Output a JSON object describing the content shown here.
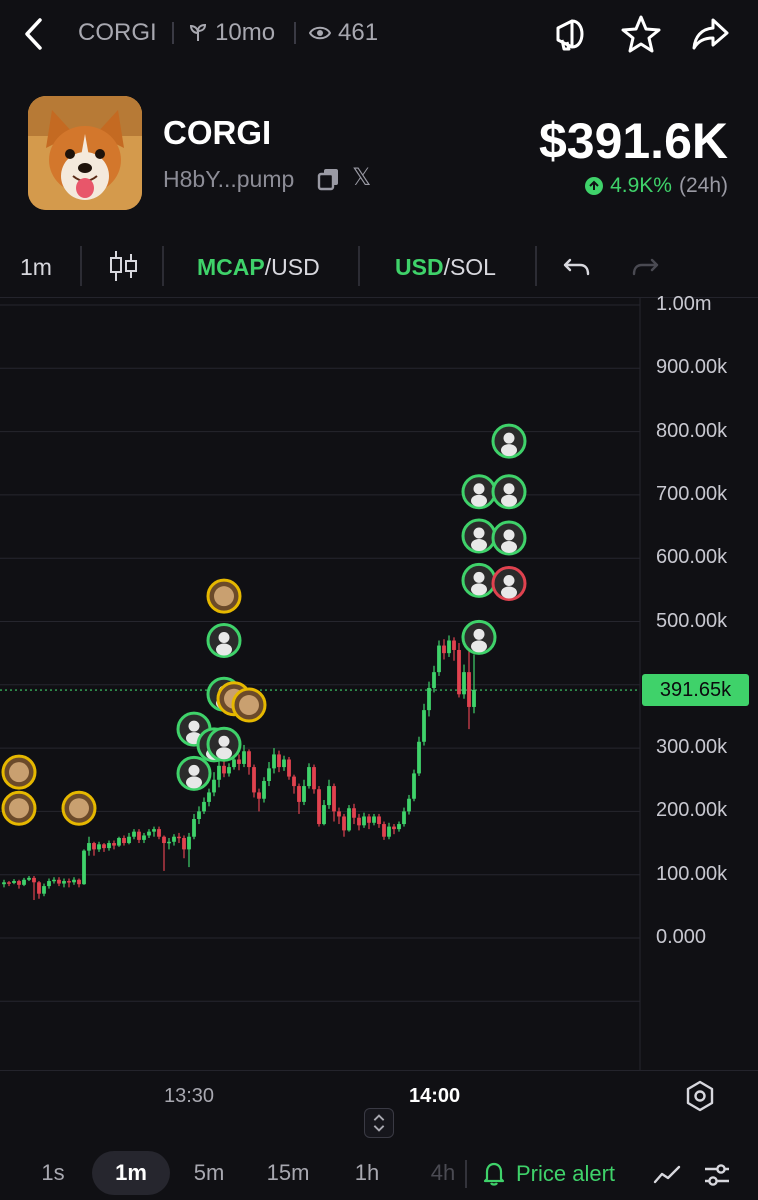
{
  "topbar": {
    "back_icon": "chevron-left-icon",
    "symbol": "CORGI",
    "age_icon": "sprout-icon",
    "age": "10mo",
    "views_icon": "eye-icon",
    "views": "461",
    "icons": [
      "megaphone-icon",
      "star-icon",
      "share-icon"
    ]
  },
  "token": {
    "name": "CORGI",
    "address": "H8bY...pump",
    "copy_icon": "copy-icon",
    "x_label": "𝕏",
    "market_cap": "$391.6K",
    "change": "4.9K%",
    "period": "(24h)",
    "accent": "#3fd26a"
  },
  "toolbar": {
    "interval": "1m",
    "candles_icon": "candlestick-icon",
    "mcap_a": "MCAP",
    "mcap_b": "/USD",
    "cur_a": "USD",
    "cur_b": "/SOL",
    "undo_icon": "undo-icon",
    "redo_icon": "redo-icon"
  },
  "chart_data": {
    "type": "candlestick",
    "y_ticks": [
      "1.00m",
      "900.00k",
      "800.00k",
      "700.00k",
      "600.00k",
      "500.00k",
      "300.00k",
      "200.00k",
      "100.00k",
      "0.000"
    ],
    "y_range": [
      -100000,
      1000000
    ],
    "x_ticks": [
      "13:30",
      "14:00"
    ],
    "last_price_label": "391.65k",
    "last_price": 391650,
    "up_color": "#3fd26a",
    "down_color": "#e0424f",
    "grid": true,
    "candles": [
      [
        85,
        88,
        80,
        92
      ],
      [
        88,
        87,
        82,
        90
      ],
      [
        87,
        90,
        85,
        93
      ],
      [
        90,
        84,
        78,
        92
      ],
      [
        84,
        92,
        82,
        95
      ],
      [
        92,
        95,
        90,
        98
      ],
      [
        95,
        88,
        60,
        98
      ],
      [
        88,
        70,
        62,
        90
      ],
      [
        70,
        82,
        66,
        86
      ],
      [
        82,
        90,
        78,
        94
      ],
      [
        90,
        92,
        86,
        96
      ],
      [
        92,
        86,
        82,
        96
      ],
      [
        86,
        90,
        80,
        94
      ],
      [
        90,
        88,
        80,
        94
      ],
      [
        88,
        92,
        84,
        96
      ],
      [
        92,
        85,
        80,
        94
      ],
      [
        85,
        138,
        84,
        140
      ],
      [
        138,
        150,
        130,
        160
      ],
      [
        150,
        140,
        130,
        152
      ],
      [
        140,
        148,
        136,
        152
      ],
      [
        148,
        142,
        136,
        150
      ],
      [
        142,
        150,
        138,
        154
      ],
      [
        150,
        146,
        140,
        154
      ],
      [
        146,
        158,
        144,
        160
      ],
      [
        158,
        150,
        146,
        162
      ],
      [
        150,
        160,
        148,
        166
      ],
      [
        160,
        168,
        156,
        172
      ],
      [
        168,
        155,
        150,
        172
      ],
      [
        155,
        162,
        150,
        166
      ],
      [
        162,
        168,
        158,
        172
      ],
      [
        168,
        172,
        160,
        176
      ],
      [
        172,
        160,
        156,
        176
      ],
      [
        160,
        150,
        106,
        162
      ],
      [
        150,
        152,
        140,
        158
      ],
      [
        152,
        160,
        146,
        164
      ],
      [
        160,
        158,
        150,
        166
      ],
      [
        158,
        140,
        126,
        162
      ],
      [
        140,
        160,
        112,
        166
      ],
      [
        160,
        188,
        156,
        196
      ],
      [
        188,
        200,
        180,
        208
      ],
      [
        200,
        215,
        196,
        222
      ],
      [
        215,
        230,
        208,
        236
      ],
      [
        230,
        250,
        224,
        262
      ],
      [
        250,
        272,
        238,
        300
      ],
      [
        272,
        260,
        254,
        280
      ],
      [
        260,
        270,
        255,
        276
      ],
      [
        270,
        282,
        266,
        290
      ],
      [
        282,
        275,
        265,
        290
      ],
      [
        275,
        295,
        270,
        305
      ],
      [
        295,
        270,
        258,
        298
      ],
      [
        270,
        230,
        222,
        274
      ],
      [
        230,
        220,
        200,
        236
      ],
      [
        220,
        248,
        214,
        254
      ],
      [
        248,
        268,
        240,
        278
      ],
      [
        268,
        290,
        260,
        300
      ],
      [
        290,
        270,
        262,
        296
      ],
      [
        270,
        282,
        264,
        288
      ],
      [
        282,
        255,
        250,
        286
      ],
      [
        255,
        240,
        228,
        258
      ],
      [
        240,
        215,
        196,
        244
      ],
      [
        215,
        240,
        210,
        250
      ],
      [
        240,
        270,
        236,
        276
      ],
      [
        270,
        235,
        228,
        274
      ],
      [
        235,
        180,
        176,
        240
      ],
      [
        180,
        210,
        178,
        218
      ],
      [
        210,
        240,
        204,
        250
      ],
      [
        240,
        200,
        184,
        244
      ],
      [
        200,
        192,
        180,
        206
      ],
      [
        192,
        170,
        160,
        196
      ],
      [
        170,
        205,
        168,
        210
      ],
      [
        205,
        190,
        180,
        212
      ],
      [
        190,
        178,
        170,
        196
      ],
      [
        178,
        192,
        174,
        198
      ],
      [
        192,
        182,
        172,
        196
      ],
      [
        182,
        192,
        178,
        196
      ],
      [
        192,
        180,
        174,
        196
      ],
      [
        180,
        160,
        155,
        184
      ],
      [
        160,
        176,
        156,
        182
      ],
      [
        176,
        172,
        164,
        180
      ],
      [
        172,
        180,
        168,
        184
      ],
      [
        180,
        200,
        176,
        206
      ],
      [
        200,
        220,
        195,
        226
      ],
      [
        220,
        260,
        216,
        266
      ],
      [
        260,
        310,
        256,
        318
      ],
      [
        310,
        360,
        304,
        370
      ],
      [
        360,
        395,
        350,
        405
      ],
      [
        395,
        420,
        388,
        430
      ],
      [
        420,
        462,
        414,
        470
      ],
      [
        462,
        450,
        440,
        472
      ],
      [
        450,
        470,
        444,
        478
      ],
      [
        470,
        455,
        438,
        475
      ],
      [
        455,
        385,
        380,
        466
      ],
      [
        385,
        420,
        378,
        432
      ],
      [
        420,
        365,
        330,
        456
      ],
      [
        365,
        392,
        355,
        448
      ]
    ],
    "markers": [
      {
        "t": 2,
        "v": 262,
        "kind": "token",
        "color": "#e6b800"
      },
      {
        "t": 2,
        "v": 205,
        "kind": "token",
        "color": "#e6b800"
      },
      {
        "t": 14,
        "v": 205,
        "kind": "token",
        "color": "#e6b800"
      },
      {
        "t": 37,
        "v": 260,
        "kind": "user",
        "color": "#3fd26a"
      },
      {
        "t": 37,
        "v": 330,
        "kind": "user",
        "color": "#3fd26a"
      },
      {
        "t": 41,
        "v": 305,
        "kind": "user",
        "color": "#3fd26a"
      },
      {
        "t": 43,
        "v": 306,
        "kind": "user",
        "color": "#3fd26a"
      },
      {
        "t": 43,
        "v": 385,
        "kind": "user",
        "color": "#3fd26a"
      },
      {
        "t": 43,
        "v": 470,
        "kind": "user",
        "color": "#3fd26a"
      },
      {
        "t": 43,
        "v": 540,
        "kind": "token",
        "color": "#e6b800"
      },
      {
        "t": 45,
        "v": 378,
        "kind": "token",
        "color": "#e6b800"
      },
      {
        "t": 48,
        "v": 368,
        "kind": "token",
        "color": "#e6b800"
      },
      {
        "t": 94,
        "v": 475,
        "kind": "user",
        "color": "#3fd26a"
      },
      {
        "t": 94,
        "v": 565,
        "kind": "user",
        "color": "#3fd26a"
      },
      {
        "t": 94,
        "v": 635,
        "kind": "user",
        "color": "#3fd26a"
      },
      {
        "t": 94,
        "v": 705,
        "kind": "user",
        "color": "#3fd26a"
      },
      {
        "t": 100,
        "v": 560,
        "kind": "user",
        "color": "#e0424f"
      },
      {
        "t": 100,
        "v": 632,
        "kind": "user",
        "color": "#3fd26a"
      },
      {
        "t": 100,
        "v": 705,
        "kind": "user",
        "color": "#3fd26a"
      },
      {
        "t": 100,
        "v": 785,
        "kind": "user",
        "color": "#3fd26a"
      }
    ]
  },
  "timeaxis": {
    "t1": "13:30",
    "t2": "14:00",
    "gear_icon": "hexagon-settings-icon",
    "expand_icon": "expand-vertical-icon"
  },
  "bottombar": {
    "intervals": [
      "1s",
      "1m",
      "5m",
      "15m",
      "1h",
      "4h"
    ],
    "active": "1m",
    "alert_label": "Price alert",
    "alert_icon": "bell-icon",
    "line_icon": "line-chart-icon",
    "settings_icon": "sliders-icon"
  }
}
